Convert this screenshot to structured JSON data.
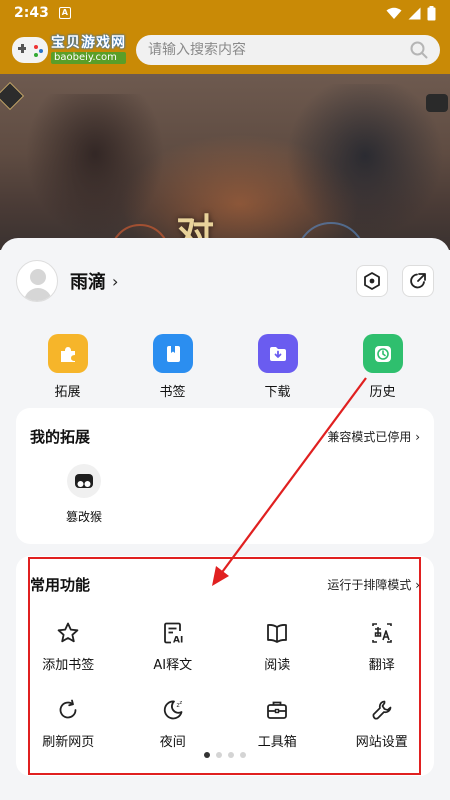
{
  "status_bar": {
    "time": "2:43",
    "notification": "A"
  },
  "header": {
    "logo_cn": "宝贝游戏网",
    "logo_en": "baobeiy.com",
    "search_placeholder": "请输入搜索内容"
  },
  "banner": {
    "title": "对"
  },
  "profile": {
    "name": "雨滴",
    "chevron": "›"
  },
  "quick_actions": [
    {
      "label": "拓展",
      "icon": "puzzle-icon",
      "color": "#f6b52a"
    },
    {
      "label": "书签",
      "icon": "bookmark-book-icon",
      "color": "#2b8ef0"
    },
    {
      "label": "下载",
      "icon": "download-folder-icon",
      "color": "#6a5cf0"
    },
    {
      "label": "历史",
      "icon": "clock-icon",
      "color": "#2fbf6e"
    }
  ],
  "extensions": {
    "title": "我的拓展",
    "status_link": "兼容模式已停用 ›",
    "items": [
      {
        "label": "篡改猴",
        "icon": "tampermonkey-icon"
      }
    ]
  },
  "functions": {
    "title": "常用功能",
    "mode_link": "运行于排障模式 ›",
    "items": [
      {
        "label": "添加书签",
        "icon": "star-icon"
      },
      {
        "label": "AI释文",
        "icon": "ai-document-icon"
      },
      {
        "label": "阅读",
        "icon": "book-open-icon"
      },
      {
        "label": "翻译",
        "icon": "translate-icon"
      },
      {
        "label": "刷新网页",
        "icon": "refresh-icon"
      },
      {
        "label": "夜间",
        "icon": "moon-icon"
      },
      {
        "label": "工具箱",
        "icon": "toolbox-icon"
      },
      {
        "label": "网站设置",
        "icon": "wrench-icon"
      }
    ],
    "pages": 4,
    "active_page": 1
  },
  "annotation": {
    "color": "#e02020"
  }
}
